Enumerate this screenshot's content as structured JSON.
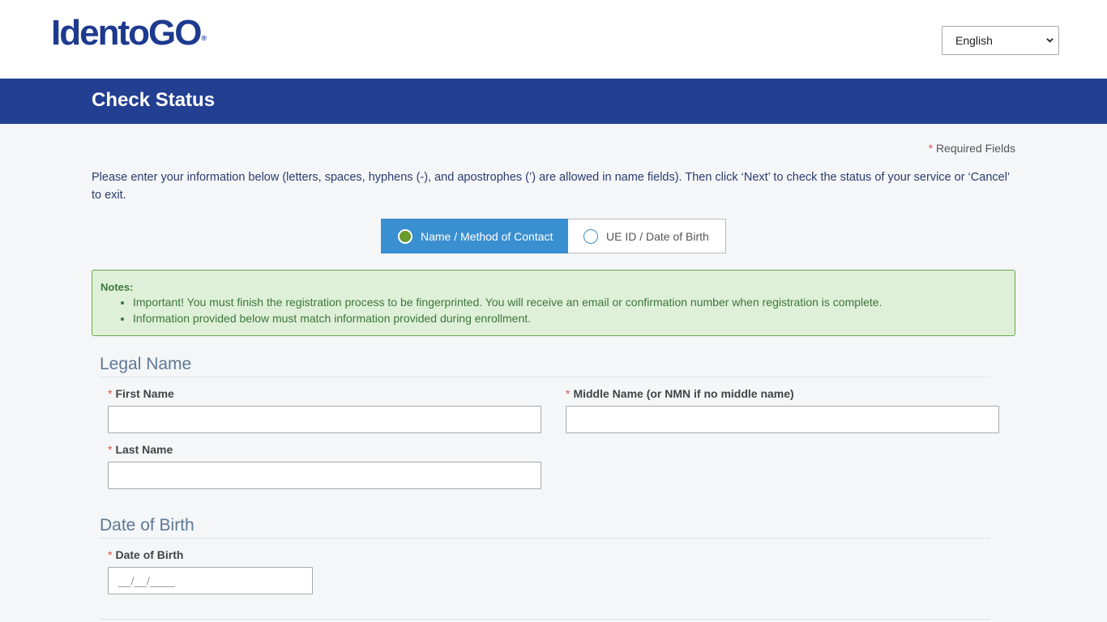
{
  "brand": {
    "logo_text": "IdentoGO",
    "logo_mark": "®"
  },
  "language": {
    "selected": "English"
  },
  "banner": {
    "title": "Check Status"
  },
  "required_note": {
    "star": "*",
    "text": "Required Fields"
  },
  "instructions": "Please enter your information below (letters, spaces, hyphens (-), and apostrophes (’) are allowed in name fields). Then click ‘Next’ to check the status of your service or ‘Cancel’ to exit.",
  "lookup_toggle": {
    "options": [
      {
        "label": "Name / Method of Contact",
        "selected": true
      },
      {
        "label": "UE ID / Date of Birth",
        "selected": false
      }
    ]
  },
  "notes": {
    "title": "Notes:",
    "items": [
      "Important! You must finish the registration process to be fingerprinted. You will receive an email or confirmation number when registration is complete.",
      "Information provided below must match information provided during enrollment."
    ]
  },
  "legal_name": {
    "title": "Legal Name",
    "first_name_label": "First Name",
    "middle_name_label": "Middle Name (or NMN if no middle name)",
    "last_name_label": "Last Name",
    "first_name_value": "",
    "middle_name_value": "",
    "last_name_value": ""
  },
  "date_of_birth": {
    "title": "Date of Birth",
    "label": "Date of Birth",
    "placeholder": "__/__/____"
  },
  "colors": {
    "brand_blue": "#233f91",
    "toggle_active": "#3a8fd0",
    "notes_bg": "#dff0d8",
    "notes_text": "#3c763d",
    "required_star": "#d9534f"
  }
}
